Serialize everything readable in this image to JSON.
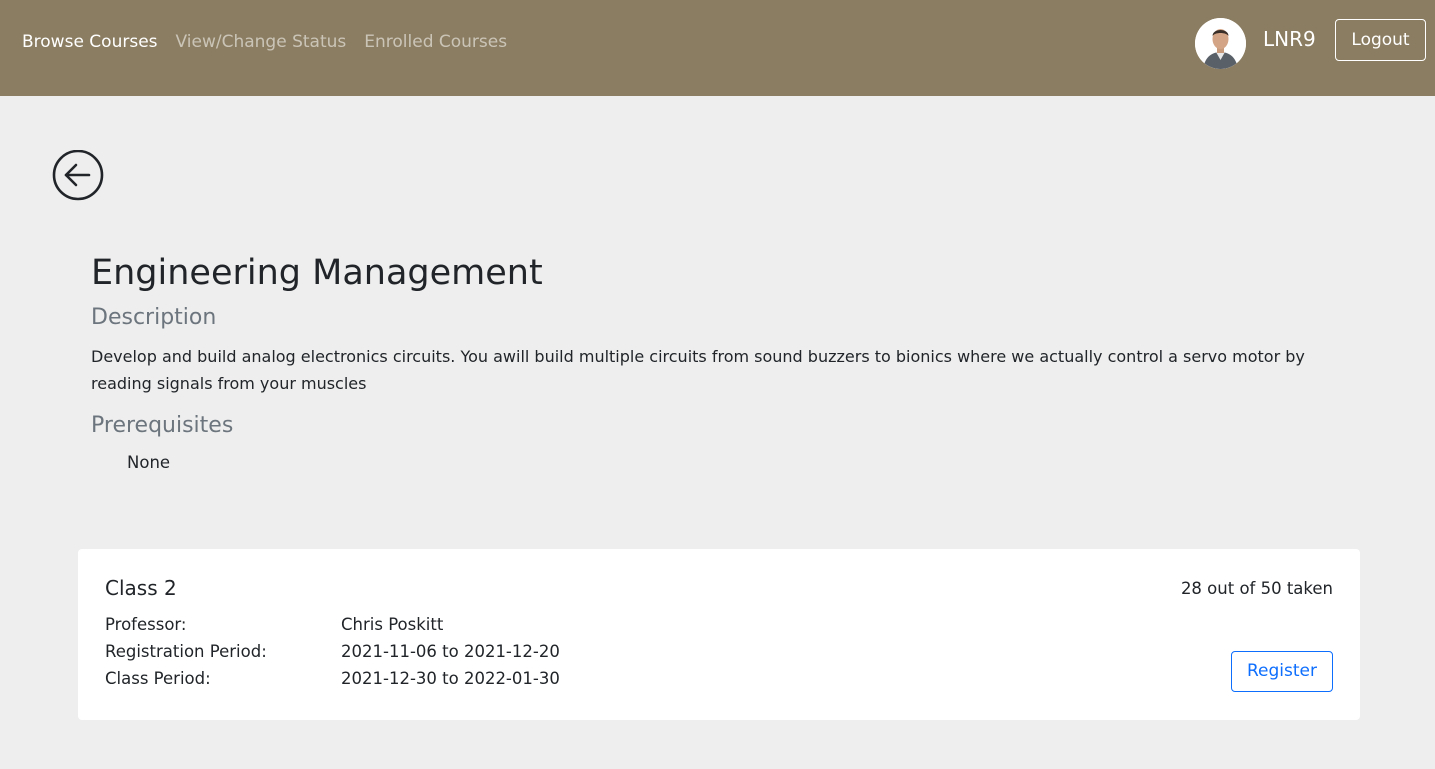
{
  "nav": {
    "links": [
      {
        "label": "Browse Courses"
      },
      {
        "label": "View/Change Status"
      },
      {
        "label": "Enrolled Courses"
      }
    ],
    "active_index": 0,
    "username": "LNR9",
    "logout_label": "Logout"
  },
  "course": {
    "title": "Engineering Management",
    "description_heading": "Description",
    "description": "Develop and build analog electronics circuits. You awill build multiple circuits from sound buzzers to bionics where we actually control a servo motor by reading signals from your muscles",
    "prerequisites_heading": "Prerequisites",
    "prerequisites": "None"
  },
  "class_card": {
    "name": "Class 2",
    "seats": "28 out of 50 taken",
    "professor_label": "Professor:",
    "professor": "Chris Poskitt",
    "registration_label": "Registration Period:",
    "registration_period": "2021-11-06 to 2021-12-20",
    "class_period_label": "Class Period:",
    "class_period": "2021-12-30 to 2022-01-30",
    "register_label": "Register"
  },
  "colors": {
    "navbar": "#8b7d61",
    "background": "#eeeeee",
    "accent": "#0d6efd",
    "muted": "#6c757d"
  },
  "icons": {
    "back": "arrow-left-circle-icon",
    "avatar": "user-photo"
  }
}
